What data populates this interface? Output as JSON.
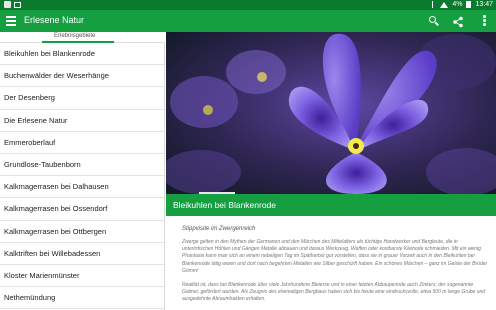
{
  "status_bar": {
    "bluetooth": "bluetooth-icon",
    "wifi": "wifi-icon",
    "battery_percent": "4%",
    "time": "13:47"
  },
  "app_bar": {
    "title": "Erlesene Natur"
  },
  "tabs": [
    {
      "label": "Erlebnisgebiete"
    }
  ],
  "list": {
    "items": [
      {
        "label": "Bleikuhlen bei Blankenrode"
      },
      {
        "label": "Buchenwälder der Weserhänge"
      },
      {
        "label": "Der Desenberg"
      },
      {
        "label": "Die Erlesene Natur"
      },
      {
        "label": "Emmeroberlauf"
      },
      {
        "label": "Grundlose-Taubenborn"
      },
      {
        "label": "Kalkmagerrasen bei Dalhausen"
      },
      {
        "label": "Kalkmagerrasen bei Ossendorf"
      },
      {
        "label": "Kalkmagerrasen bei Ottbergen"
      },
      {
        "label": "Kalktriften bei Willebadessen"
      },
      {
        "label": "Kloster Marienmünster"
      },
      {
        "label": "Nethemündung"
      }
    ]
  },
  "detail": {
    "title": "Bleikuhlen bei Blankenrode",
    "subtitle": "Stippvisite im Zwergenreich",
    "paragraphs": [
      "Zwerge gelten in den Mythen der Germanen und den Märchen des Mittelalters als tüchtige Handwerker und Bergleute, die in unterirdischen Höhlen und Gängen Metalle abbauen und daraus Werkzeug, Waffen oder kostbarste Kleinode schmieden. Mit ein wenig Phantasie kann man sich an einem nebeligen Tag im Spätherbst gut vorstellen, dass sie in grauer Vorzeit auch in den Bleikuhlen bei Blankenrode tätig waren und dort nach begehrten Metallen wie Silber geschürft haben. Ein schönes Märchen – ganz im Geiste der Brüder Grimm!",
      "Realität ist, dass bei Blankenrode über viele Jahrhunderte Bleierze und in einer letzten Abbauperiode auch Zinkerz, der sogenannte Galmei, gefördert wurden. Als Zeugnis des ehemaligen Bergbaus haben sich bis heute eine eindrucksvolle, etwa 500 m lange Grube und ausgedehnte Abraumhalden erhalten."
    ]
  },
  "colors": {
    "primary": "#169f41",
    "status_bar": "#097a2e",
    "tab_indicator": "#169f41"
  }
}
